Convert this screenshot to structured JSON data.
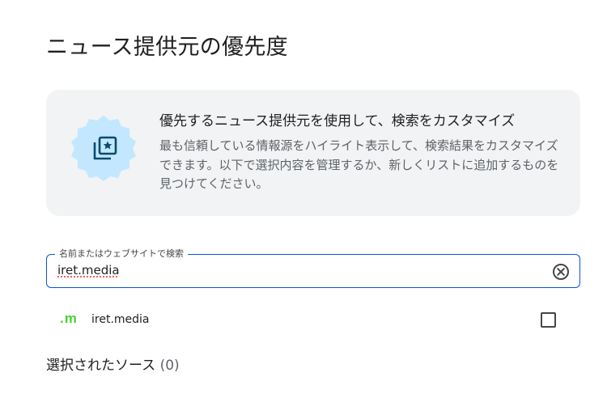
{
  "page": {
    "title": "ニュース提供元の優先度"
  },
  "info_card": {
    "icon": "news-sources-badge-icon",
    "heading": "優先するニュース提供元を使用して、検索をカスタマイズ",
    "body": "最も信頼している情報源をハイライト表示して、検索結果をカスタマイズできます。以下で選択内容を管理するか、新しくリストに追加するものを見つけてください。"
  },
  "search": {
    "label": "名前またはウェブサイトで検索",
    "value": "iret.media",
    "clear_icon": "clear-circle-icon"
  },
  "results": [
    {
      "favicon_text": ".m",
      "name": "iret.media",
      "checked": false
    }
  ],
  "selected": {
    "label": "選択されたソース",
    "count": "(0)"
  },
  "colors": {
    "accent": "#0b57d0",
    "badge_bg": "#c2e7ff",
    "badge_icon": "#0b4a6f",
    "card_bg": "#f1f3f4",
    "favicon": "#4cd137"
  }
}
